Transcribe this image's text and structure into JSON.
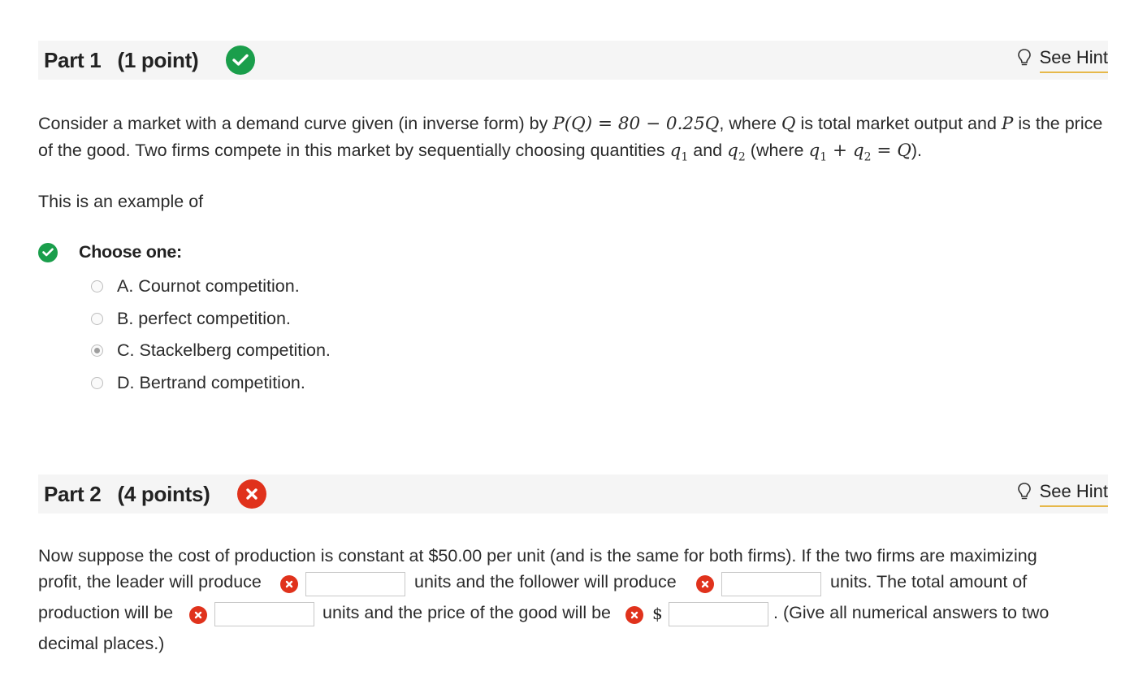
{
  "part1": {
    "title": "Part 1",
    "points": "(1 point)",
    "status": "correct",
    "hint_label": "See Hint",
    "question": {
      "t1": "Consider a market with a demand curve given (in inverse form) by ",
      "m1": "P(Q) = 80 − 0.25Q",
      "t2": ", where ",
      "m2": "Q",
      "t3": " is total market output and ",
      "m3": "P",
      "t4": " is the price of the good. Two firms compete in this market by sequentially choosing quantities ",
      "q1": "q",
      "q1_sub": "1",
      "t5": " and ",
      "q2": "q",
      "q2_sub": "2",
      "t6": " (where ",
      "m4": "q1 + q2 = Q",
      "t7": ")."
    },
    "prompt": "This is an example of",
    "choose_label": "Choose one:",
    "options": [
      {
        "label": "A. Cournot competition.",
        "selected": false
      },
      {
        "label": "B. perfect competition.",
        "selected": false
      },
      {
        "label": "C. Stackelberg competition.",
        "selected": true
      },
      {
        "label": "D. Bertrand competition.",
        "selected": false
      }
    ]
  },
  "part2": {
    "title": "Part 2",
    "points": "(4 points)",
    "status": "incorrect",
    "hint_label": "See Hint",
    "line1": "Now suppose the cost of production is constant at $50.00 per unit (and is the same for both firms). If the two firms are maximizing",
    "line2a": "profit, the leader will produce",
    "line2b": "units and the follower will produce",
    "line2c": "units. The total amount of",
    "line3a": "production will be",
    "line3b": "units and the price of the good will be",
    "dollar": "$",
    "line3c": ". (Give all numerical answers to two",
    "line4": "decimal places.)",
    "answers": {
      "leader": "",
      "follower": "",
      "total": "",
      "price": ""
    }
  },
  "colors": {
    "correct": "#1a9e4b",
    "incorrect": "#e0321c",
    "hint_underline": "#e6b84a",
    "header_bg": "#f5f5f5"
  },
  "icons": {
    "correct": "checkmark-circle-icon",
    "incorrect": "x-circle-icon",
    "hint": "lightbulb-icon"
  }
}
